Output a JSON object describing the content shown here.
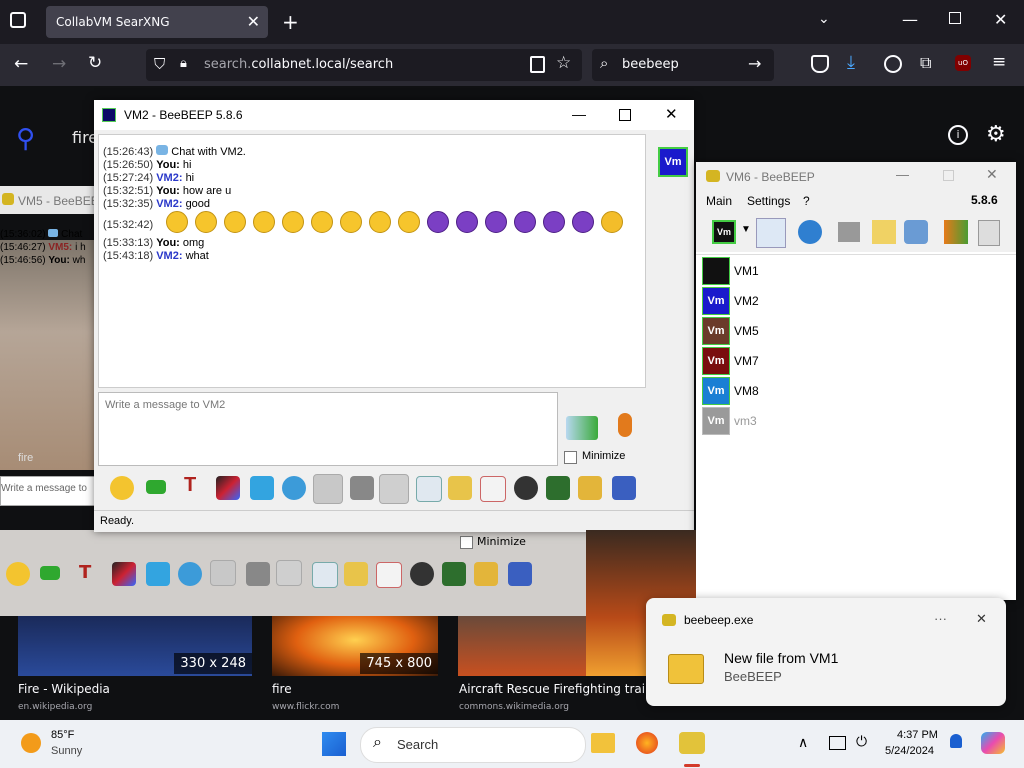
{
  "browser": {
    "tab_title": "CollabVM SearXNG",
    "url_domain": "search.",
    "url_rest": "collabnet.local/search",
    "search_text": "beebeep"
  },
  "searx": {
    "query_partial": "fire"
  },
  "vm5_window": {
    "title": "VM5 - BeeBEEP",
    "messages": [
      {
        "ts": "(15:36:02)",
        "who": "",
        "text": "Chat"
      },
      {
        "ts": "(15:46:27)",
        "who": "VM5:",
        "text": "i h"
      },
      {
        "ts": "(15:46:56)",
        "who": "You:",
        "text": "wh"
      }
    ],
    "input_placeholder": "Write a message to",
    "minimize_label": "Minimize",
    "status_partial": "fire"
  },
  "vm2_window": {
    "title": "VM2 - BeeBEEP 5.8.6",
    "messages": [
      {
        "ts": "(15:26:43)",
        "who": "",
        "text": "Chat with VM2."
      },
      {
        "ts": "(15:26:50)",
        "who": "You:",
        "text": "hi"
      },
      {
        "ts": "(15:27:24)",
        "who": "VM2:",
        "text": "hi"
      },
      {
        "ts": "(15:32:51)",
        "who": "You:",
        "text": "how are u"
      },
      {
        "ts": "(15:32:35)",
        "who": "VM2:",
        "text": "good"
      },
      {
        "ts": "(15:32:42)",
        "who": "",
        "text": ""
      },
      {
        "ts": "(15:33:13)",
        "who": "You:",
        "text": "omg"
      },
      {
        "ts": "(15:43:18)",
        "who": "VM2:",
        "text": "what"
      }
    ],
    "input_placeholder": "Write a message to VM2",
    "minimize_label": "Minimize",
    "status": "Ready.",
    "avatar_label": "Vm"
  },
  "vm6_window": {
    "title": "VM6 - BeeBEEP",
    "menu": [
      "Main",
      "Settings",
      "?"
    ],
    "version": "5.8.6",
    "users": [
      {
        "name": "VM1",
        "color": "#111111",
        "label": ""
      },
      {
        "name": "VM2",
        "color": "#1a1acc",
        "label": "Vm"
      },
      {
        "name": "VM5",
        "color": "#6b3b2a",
        "label": "Vm"
      },
      {
        "name": "VM7",
        "color": "#7a0e0e",
        "label": "Vm"
      },
      {
        "name": "VM8",
        "color": "#1a7fd4",
        "label": "Vm"
      },
      {
        "name": "vm3",
        "color": "#9a9a9a",
        "label": "Vm"
      }
    ]
  },
  "results": [
    {
      "title": "Fire - Wikipedia",
      "source": "en.wikipedia.org",
      "dims": "330 x 248"
    },
    {
      "title": "fire",
      "source": "www.flickr.com",
      "dims": "745 x 800"
    },
    {
      "title": "Aircraft Rescue Firefighting train",
      "source": "commons.wikimedia.org",
      "dims": ""
    }
  ],
  "notification": {
    "app": "beebeep.exe",
    "title": "New file from VM1",
    "body": "BeeBEEP",
    "more": "···"
  },
  "taskbar": {
    "weather_temp": "85°F",
    "weather_desc": "Sunny",
    "search_label": "Search",
    "time": "4:37 PM",
    "date": "5/24/2024"
  }
}
